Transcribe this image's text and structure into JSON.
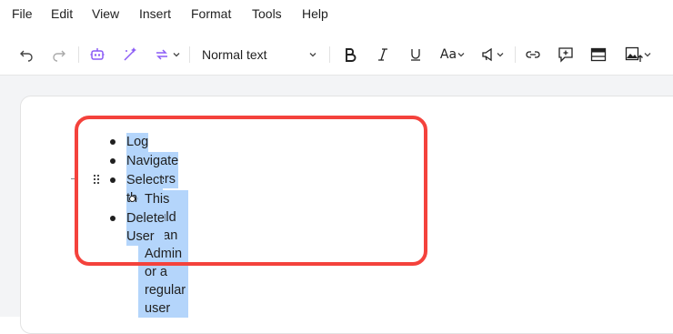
{
  "menu": {
    "items": [
      "File",
      "Edit",
      "View",
      "Insert",
      "Format",
      "Tools",
      "Help"
    ]
  },
  "toolbar": {
    "paragraph_style": "Normal text",
    "text_case_label": "Aa",
    "icons": [
      "undo-icon",
      "redo-icon",
      "ai-assistant-icon",
      "magic-wand-icon",
      "convert-icon",
      "bold-icon",
      "italic-icon",
      "underline-icon",
      "announce-icon",
      "link-icon",
      "comment-icon",
      "table-icon",
      "image-icon"
    ]
  },
  "document": {
    "items": [
      {
        "text": "Log in",
        "level": 1
      },
      {
        "text": "Navigate to Users",
        "level": 1
      },
      {
        "text": "Select the user",
        "level": 1
      },
      {
        "text": "This could be an Admin or a regular user",
        "level": 2
      },
      {
        "text": "Delete User",
        "level": 1
      }
    ]
  },
  "colors": {
    "selection": "#b4d5fb",
    "annotation": "#f4423c",
    "accent": "#8b5cf6"
  }
}
